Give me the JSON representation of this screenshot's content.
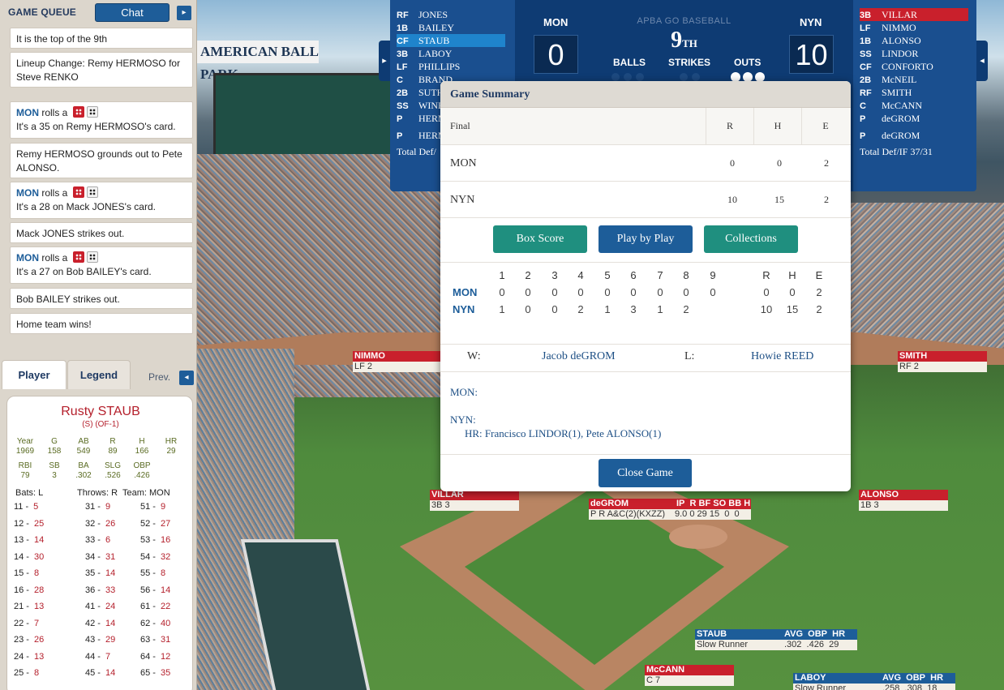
{
  "game_queue": {
    "title": "GAME QUEUE",
    "chat_label": "Chat",
    "next_arrow": "▸",
    "messages": [
      {
        "text": "It is the top of the 9th"
      },
      {
        "text": "Lineup Change: Remy HERMOSO for Steve RENKO"
      },
      {
        "team": "MON",
        "pre": "rolls a",
        "text": "It's a 35 on Remy HERMOSO's card."
      },
      {
        "text": "Remy HERMOSO grounds out to Pete ALONSO."
      },
      {
        "team": "MON",
        "pre": "rolls a",
        "text": "It's a 28 on Mack JONES's card."
      },
      {
        "text": "Mack JONES strikes out."
      },
      {
        "team": "MON",
        "pre": "rolls a",
        "text": "It's a 27 on Bob BAILEY's card."
      },
      {
        "text": "Bob BAILEY strikes out."
      },
      {
        "text": "Home team wins!"
      }
    ]
  },
  "tabs": {
    "player": "Player",
    "legend": "Legend",
    "prev": "Prev.",
    "prev_arrow": "◂"
  },
  "player_card": {
    "name": "Rusty STAUB",
    "positions": "(S) (OF-1)",
    "stats_headers_1": [
      "Year",
      "G",
      "AB",
      "R",
      "H",
      "HR"
    ],
    "stats_values_1": [
      "1969",
      "158",
      "549",
      "89",
      "166",
      "29"
    ],
    "stats_headers_2": [
      "RBI",
      "SB",
      "BA",
      "SLG",
      "OBP"
    ],
    "stats_values_2": [
      "79",
      "3",
      ".302",
      ".526",
      ".426"
    ],
    "bats": "Bats: L",
    "throws": "Throws: R",
    "team": "Team: MON",
    "rows": [
      [
        [
          "11 -",
          "5"
        ],
        [
          "31 -",
          "9"
        ],
        [
          "51 -",
          "9"
        ]
      ],
      [
        [
          "12 -",
          "25"
        ],
        [
          "32 -",
          "26"
        ],
        [
          "52 -",
          "27"
        ]
      ],
      [
        [
          "13 -",
          "14"
        ],
        [
          "33 -",
          "6"
        ],
        [
          "53 -",
          "16"
        ]
      ],
      [
        [
          "14 -",
          "30"
        ],
        [
          "34 -",
          "31"
        ],
        [
          "54 -",
          "32"
        ]
      ],
      [
        [
          "15 -",
          "8"
        ],
        [
          "35 -",
          "14"
        ],
        [
          "55 -",
          "8"
        ]
      ],
      [
        [
          "16 -",
          "28"
        ],
        [
          "36 -",
          "33"
        ],
        [
          "56 -",
          "14"
        ]
      ],
      [
        [
          "21 -",
          "13"
        ],
        [
          "41 -",
          "24"
        ],
        [
          "61 -",
          "22"
        ]
      ],
      [
        [
          "22 -",
          "7"
        ],
        [
          "42 -",
          "14"
        ],
        [
          "62 -",
          "40"
        ]
      ],
      [
        [
          "23 -",
          "26"
        ],
        [
          "43 -",
          "29"
        ],
        [
          "63 -",
          "31"
        ]
      ],
      [
        [
          "24 -",
          "13"
        ],
        [
          "44 -",
          "7"
        ],
        [
          "64 -",
          "12"
        ]
      ],
      [
        [
          "25 -",
          "8"
        ],
        [
          "45 -",
          "14"
        ],
        [
          "65 -",
          "35"
        ]
      ]
    ]
  },
  "lineup_away": {
    "rows": [
      [
        "RF",
        "JONES"
      ],
      [
        "1B",
        "BAILEY"
      ],
      [
        "CF",
        "STAUB"
      ],
      [
        "3B",
        "LABOY"
      ],
      [
        "LF",
        "PHILLIPS"
      ],
      [
        "C",
        "BRAND"
      ],
      [
        "2B",
        "SUTH"
      ],
      [
        "SS",
        "WINE"
      ],
      [
        "P",
        "HERM"
      ],
      [
        "P",
        "HERM"
      ]
    ],
    "footer": "Total Def/"
  },
  "lineup_home": {
    "rows": [
      [
        "3B",
        "VILLAR"
      ],
      [
        "LF",
        "NIMMO"
      ],
      [
        "1B",
        "ALONSO"
      ],
      [
        "SS",
        "LINDOR"
      ],
      [
        "CF",
        "CONFORTO"
      ],
      [
        "2B",
        "McNEIL"
      ],
      [
        "RF",
        "SMITH"
      ],
      [
        "C",
        "McCANN"
      ],
      [
        "P",
        "deGROM"
      ],
      [
        "P",
        "deGROM"
      ]
    ],
    "footer": "Total Def/IF  37/31"
  },
  "scoreboard": {
    "away_team": "MON",
    "away_score": "0",
    "home_team": "NYN",
    "home_score": "10",
    "brand": "APBA GO BASEBALL",
    "inning": "9",
    "inning_suffix": "TH",
    "balls_label": "BALLS",
    "strikes_label": "STRIKES",
    "outs_label": "OUTS",
    "balls": 0,
    "strikes": 0,
    "outs": 3
  },
  "summary": {
    "title": "Game Summary",
    "status": "Final",
    "headers": [
      "R",
      "H",
      "E"
    ],
    "teams": [
      {
        "name": "MON",
        "r": "0",
        "h": "0",
        "e": "2"
      },
      {
        "name": "NYN",
        "r": "10",
        "h": "15",
        "e": "2"
      }
    ],
    "buttons": {
      "box_score": "Box Score",
      "play_by_play": "Play by Play",
      "collections": "Collections"
    },
    "innings": [
      "1",
      "2",
      "3",
      "4",
      "5",
      "6",
      "7",
      "8",
      "9"
    ],
    "rhe": [
      "R",
      "H",
      "E"
    ],
    "linescore": [
      {
        "team": "MON",
        "innings": [
          "0",
          "0",
          "0",
          "0",
          "0",
          "0",
          "0",
          "0",
          "0"
        ],
        "rhe": [
          "0",
          "0",
          "2"
        ]
      },
      {
        "team": "NYN",
        "innings": [
          "1",
          "0",
          "0",
          "2",
          "1",
          "3",
          "1",
          "2",
          ""
        ],
        "rhe": [
          "10",
          "15",
          "2"
        ]
      }
    ],
    "w_label": "W:",
    "winner": "Jacob deGROM",
    "l_label": "L:",
    "loser": "Howie REED",
    "mon_label": "MON:",
    "nyn_label": "NYN:",
    "nyn_hr": "HR: Francisco LINDOR(1), Pete ALONSO(1)",
    "close": "Close Game"
  },
  "field": {
    "nimmo": {
      "name": "NIMMO",
      "sub": "LF 2"
    },
    "smith": {
      "name": "SMITH",
      "sub": "RF 2"
    },
    "villar": {
      "name": "VILLAR",
      "sub": "3B 3"
    },
    "alonso": {
      "name": "ALONSO",
      "sub": "1B 3"
    },
    "degrom": {
      "name": "deGROM",
      "sub": "P R A&C(2)(KXZZ)",
      "stat_h": [
        "IP",
        "R",
        "BF",
        "SO",
        "BB",
        "H"
      ],
      "stat_v": [
        "9.0",
        "0",
        "29",
        "15",
        "0",
        "0"
      ]
    },
    "staub": {
      "name": "STAUB",
      "sub": "Slow Runner",
      "stat_h": [
        "AVG",
        "OBP",
        "HR"
      ],
      "stat_v": [
        ".302",
        ".426",
        "29"
      ]
    },
    "mccann": {
      "name": "McCANN",
      "sub": "C 7"
    },
    "laboy": {
      "name": "LABOY",
      "sub": "Slow Runner",
      "stat_h": [
        "AVG",
        "OBP",
        "HR"
      ],
      "stat_v": [
        ".258",
        ".308",
        "18"
      ]
    },
    "ballpark_sign": "AMERICAN BALL PARK"
  }
}
